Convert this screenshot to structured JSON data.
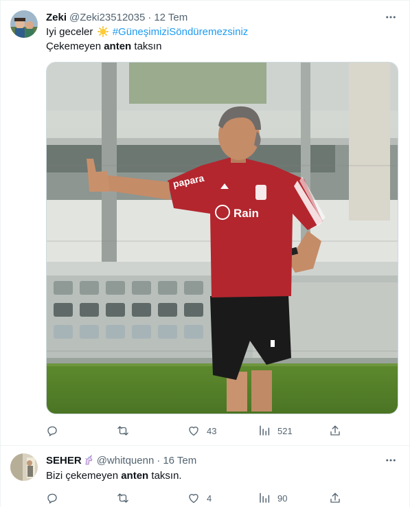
{
  "tweets": [
    {
      "author_name": "Zeki",
      "author_handle": "@Zeki23512035",
      "separator": "·",
      "date": "12 Tem",
      "line1_text": "Iyi geceler",
      "sun_emoji": "sun-icon",
      "hashtag": "#GüneşimiziSöndüremezsiniz",
      "line2_prefix": "Çekemeyen ",
      "line2_bold": "anten",
      "line2_suffix": " taksın",
      "replies": "",
      "retweets": "",
      "likes": "43",
      "views": "521"
    },
    {
      "author_name": "SEHER",
      "author_badge": "unicorn-icon",
      "author_handle": "@whitquenn",
      "separator": "·",
      "date": "16 Tem",
      "text_prefix": "Bizi çekemeyen ",
      "text_bold": "anten",
      "text_suffix": " taksın.",
      "replies": "",
      "retweets": "",
      "likes": "4",
      "views": "90"
    }
  ],
  "colors": {
    "text": "#0f1419",
    "secondary": "#536471",
    "link": "#1d9bf0",
    "border": "#eff3f4",
    "jersey": "#b3262e"
  },
  "icons": [
    "reply-icon",
    "retweet-icon",
    "like-icon",
    "views-icon",
    "share-icon",
    "more-icon"
  ]
}
